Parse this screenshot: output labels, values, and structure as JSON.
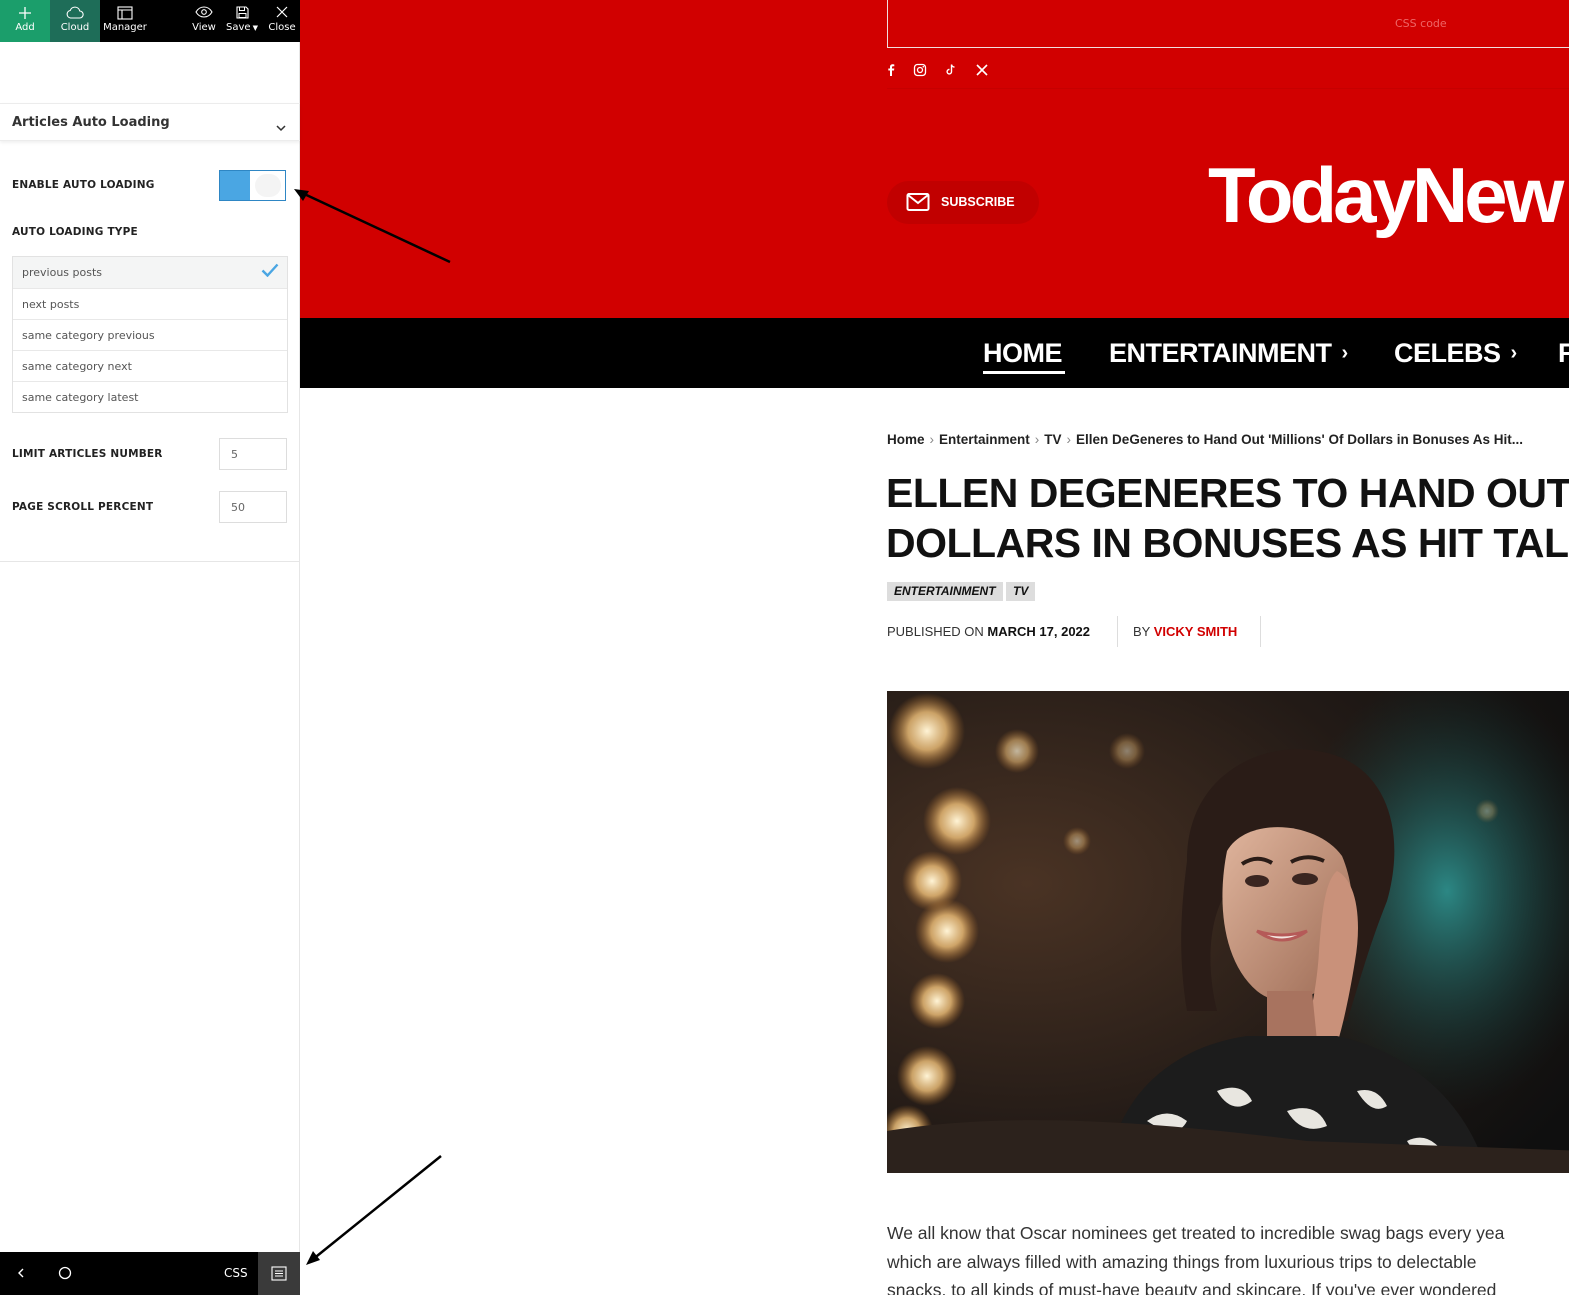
{
  "toolbar": {
    "add": "Add",
    "cloud": "Cloud",
    "manager": "Manager",
    "view": "View",
    "save": "Save",
    "close": "Close"
  },
  "panel": {
    "section_title": "Articles Auto Loading",
    "enable_label": "ENABLE AUTO LOADING",
    "enable_on": true,
    "type_label": "AUTO LOADING TYPE",
    "types": [
      "previous posts",
      "next posts",
      "same category previous",
      "same category next",
      "same category latest"
    ],
    "selected_type": "previous posts",
    "limit_label": "LIMIT ARTICLES NUMBER",
    "limit_value": "5",
    "scroll_label": "PAGE SCROLL PERCENT",
    "scroll_value": "50"
  },
  "bottombar": {
    "css": "CSS"
  },
  "site": {
    "css_placeholder": "CSS code",
    "subscribe": "SUBSCRIBE",
    "logo": "TodayNew",
    "nav": [
      "HOME",
      "ENTERTAINMENT",
      "CELEBS",
      "F"
    ],
    "breadcrumb": [
      "Home",
      "Entertainment",
      "TV",
      "Ellen DeGeneres to Hand Out 'Millions' Of Dollars in Bonuses As Hit..."
    ],
    "title_line1": "ELLEN DEGENERES TO HAND OUT",
    "title_line2": "DOLLARS IN BONUSES AS HIT TAL",
    "tags": [
      "ENTERTAINMENT",
      "TV"
    ],
    "published_prefix": "PUBLISHED ON ",
    "published_date": "MARCH 17, 2022",
    "by_prefix": "BY ",
    "author": "VICKY SMITH",
    "body_line1": "We all know that Oscar nominees get treated to incredible swag bags every yea",
    "body_line2": "which are always filled with amazing things from luxurious trips to delectable",
    "body_line3": "snacks, to all kinds of must-have beauty and skincare. If you've ever wondered"
  },
  "colors": {
    "brand_red": "#d10000",
    "toggle_blue": "#4aa6e3",
    "toolbar_green": "#1b9e6b"
  }
}
